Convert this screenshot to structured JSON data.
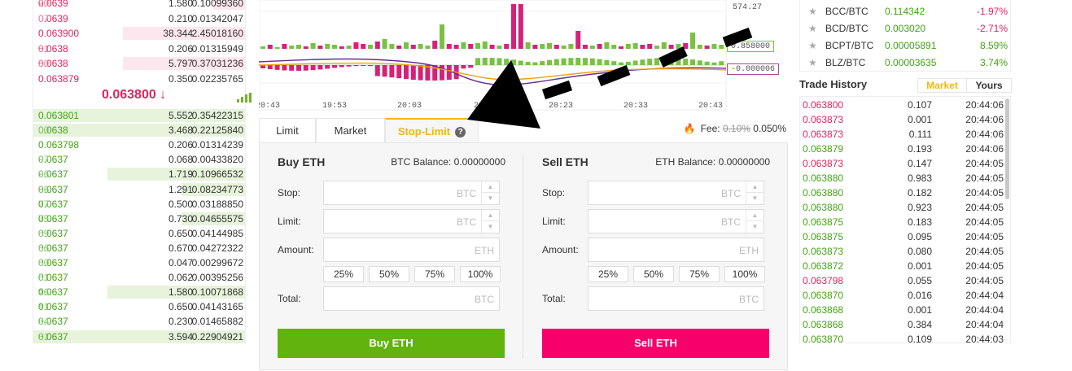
{
  "order_book": {
    "asks": [
      {
        "price_hi": "0.0639",
        "price_lo": "20",
        "amount": "1.580",
        "total": "0.10099360",
        "depth": 0.26
      },
      {
        "price_hi": "0.0639",
        "price_lo": "07",
        "amount": "0.210",
        "total": "0.01342047",
        "depth": 0.0
      },
      {
        "price_hi": "0.063900",
        "price_lo": "",
        "amount": "38.344",
        "total": "2.45018160",
        "depth": 1.0
      },
      {
        "price_hi": "0.0638",
        "price_lo": "81",
        "amount": "0.206",
        "total": "0.01315949",
        "depth": 0.0
      },
      {
        "price_hi": "0.0638",
        "price_lo": "80",
        "amount": "5.797",
        "total": "0.37031236",
        "depth": 1.0
      },
      {
        "price_hi": "0.063879",
        "price_lo": "",
        "amount": "0.350",
        "total": "0.02235765",
        "depth": 0.0
      }
    ],
    "mid_price": "0.063800 ↓",
    "bids": [
      {
        "price_hi": "0.063801",
        "price_lo": "",
        "amount": "5.552",
        "total": "0.35422315",
        "depth": 1.0
      },
      {
        "price_hi": "0.0638",
        "price_lo": "00",
        "amount": "3.468",
        "total": "0.22125840",
        "depth": 1.0
      },
      {
        "price_hi": "0.063798",
        "price_lo": "",
        "amount": "0.206",
        "total": "0.01314239",
        "depth": 0.0
      },
      {
        "price_hi": "0.0637",
        "price_lo": "97",
        "amount": "0.068",
        "total": "0.00433820",
        "depth": 0.0
      },
      {
        "price_hi": "0.0637",
        "price_lo": "96",
        "amount": "1.719",
        "total": "0.10966532",
        "depth": 0.65
      },
      {
        "price_hi": "0.0637",
        "price_lo": "86",
        "amount": "1.291",
        "total": "0.08234773",
        "depth": 0.3
      },
      {
        "price_hi": "0.0637",
        "price_lo": "77",
        "amount": "0.500",
        "total": "0.03188850",
        "depth": 0.0
      },
      {
        "price_hi": "0.0637",
        "price_lo": "75",
        "amount": "0.730",
        "total": "0.04655575",
        "depth": 0.3
      },
      {
        "price_hi": "0.0637",
        "price_lo": "69",
        "amount": "0.650",
        "total": "0.04144985",
        "depth": 0.0
      },
      {
        "price_hi": "0.0637",
        "price_lo": "66",
        "amount": "0.670",
        "total": "0.04272322",
        "depth": 0.0
      },
      {
        "price_hi": "0.0637",
        "price_lo": "60",
        "amount": "0.047",
        "total": "0.00299672",
        "depth": 0.0
      },
      {
        "price_hi": "0.0637",
        "price_lo": "51",
        "amount": "0.062",
        "total": "0.00395256",
        "depth": 0.0
      },
      {
        "price_hi": "0.0637",
        "price_lo": "46",
        "amount": "1.580",
        "total": "0.10071868",
        "depth": 0.65
      },
      {
        "price_hi": "0.0637",
        "price_lo": "41",
        "amount": "0.650",
        "total": "0.04143165",
        "depth": 0.0
      },
      {
        "price_hi": "0.0637",
        "price_lo": "34",
        "amount": "0.230",
        "total": "0.01465882",
        "depth": 0.0
      },
      {
        "price_hi": "0.0637",
        "price_lo": "31",
        "amount": "3.594",
        "total": "0.22904921",
        "depth": 1.0
      }
    ]
  },
  "chart": {
    "price_tag": "574.27",
    "tag_right_top": "0.858000",
    "tag_right_bottom": "-0.000006",
    "times": [
      "20:43",
      "19:53",
      "20:03",
      "20:13",
      "20:23",
      "20:33",
      "20:43"
    ]
  },
  "trade": {
    "tabs": [
      "Limit",
      "Market",
      "Stop-Limit"
    ],
    "help_icon": "?",
    "fee_label": "Fee:",
    "fee_old": "0.10%",
    "fee_new": "0.050%",
    "fire_icon": "fire-icon",
    "buy": {
      "title": "Buy ETH",
      "balance": "BTC Balance: 0.00000000",
      "stop_label": "Stop:",
      "limit_label": "Limit:",
      "amount_label": "Amount:",
      "total_label": "Total:",
      "stop_unit": "BTC",
      "limit_unit": "BTC",
      "amount_unit": "ETH",
      "total_unit": "BTC",
      "pcts": [
        "25%",
        "50%",
        "75%",
        "100%"
      ],
      "button": "Buy ETH"
    },
    "sell": {
      "title": "Sell ETH",
      "balance": "ETH Balance: 0.00000000",
      "stop_label": "Stop:",
      "limit_label": "Limit:",
      "amount_label": "Amount:",
      "total_label": "Total:",
      "stop_unit": "BTC",
      "limit_unit": "BTC",
      "amount_unit": "ETH",
      "total_unit": "BTC",
      "pcts": [
        "25%",
        "50%",
        "75%",
        "100%"
      ],
      "button": "Sell ETH"
    }
  },
  "markets": [
    {
      "pair": "BCC/BTC",
      "price": "0.114342",
      "change": "-1.97%",
      "up": false
    },
    {
      "pair": "BCD/BTC",
      "price": "0.003020",
      "change": "-2.71%",
      "up": false
    },
    {
      "pair": "BCPT/BTC",
      "price": "0.00005891",
      "change": "8.59%",
      "up": true
    },
    {
      "pair": "BLZ/BTC",
      "price": "0.00003635",
      "change": "3.74%",
      "up": true
    }
  ],
  "trade_history": {
    "title": "Trade History",
    "tab_market": "Market",
    "tab_yours": "Yours",
    "rows": [
      {
        "price": "0.063800",
        "amount": "0.107",
        "time": "20:44:06",
        "up": false
      },
      {
        "price": "0.063873",
        "amount": "0.001",
        "time": "20:44:06",
        "up": false
      },
      {
        "price": "0.063873",
        "amount": "0.111",
        "time": "20:44:06",
        "up": false
      },
      {
        "price": "0.063879",
        "amount": "0.193",
        "time": "20:44:06",
        "up": true
      },
      {
        "price": "0.063873",
        "amount": "0.147",
        "time": "20:44:05",
        "up": false
      },
      {
        "price": "0.063880",
        "amount": "0.983",
        "time": "20:44:05",
        "up": true
      },
      {
        "price": "0.063880",
        "amount": "0.182",
        "time": "20:44:05",
        "up": true
      },
      {
        "price": "0.063880",
        "amount": "0.923",
        "time": "20:44:05",
        "up": true
      },
      {
        "price": "0.063875",
        "amount": "0.183",
        "time": "20:44:05",
        "up": true
      },
      {
        "price": "0.063875",
        "amount": "0.095",
        "time": "20:44:05",
        "up": true
      },
      {
        "price": "0.063873",
        "amount": "0.080",
        "time": "20:44:05",
        "up": true
      },
      {
        "price": "0.063872",
        "amount": "0.001",
        "time": "20:44:05",
        "up": true
      },
      {
        "price": "0.063798",
        "amount": "0.055",
        "time": "20:44:05",
        "up": false
      },
      {
        "price": "0.063870",
        "amount": "0.016",
        "time": "20:44:04",
        "up": true
      },
      {
        "price": "0.063868",
        "amount": "0.001",
        "time": "20:44:04",
        "up": true
      },
      {
        "price": "0.063868",
        "amount": "0.384",
        "time": "20:44:04",
        "up": true
      },
      {
        "price": "0.063870",
        "amount": "0.109",
        "time": "20:44:03",
        "up": true
      }
    ]
  },
  "colors": {
    "up": "#43a314",
    "down": "#e0245e",
    "accent": "#f0b90b",
    "buy_button": "#62b30d",
    "sell_button": "#f7006b"
  }
}
